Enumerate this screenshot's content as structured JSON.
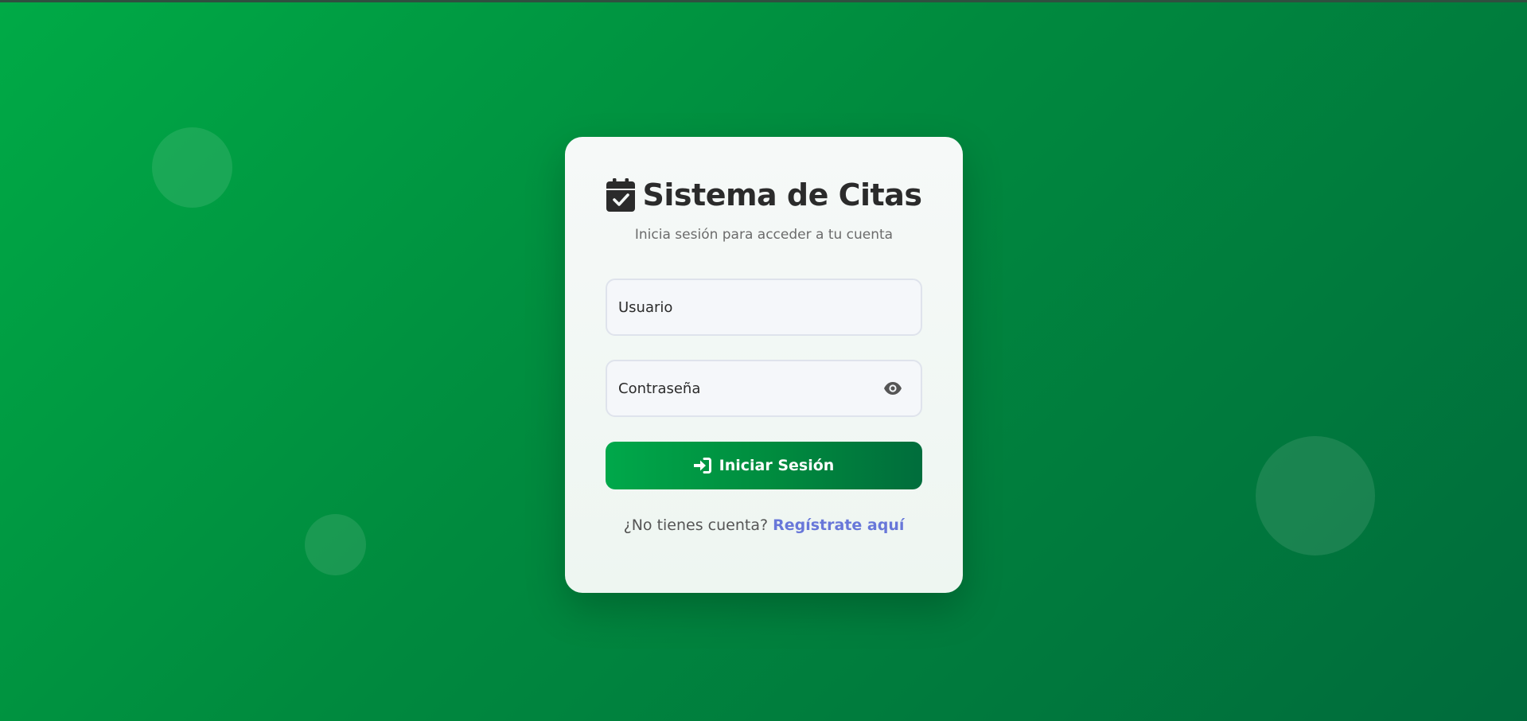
{
  "header": {
    "title": "Sistema de Citas",
    "subtitle": "Inicia sesión para acceder a tu cuenta",
    "icon": "calendar-check-icon"
  },
  "form": {
    "username": {
      "placeholder": "Usuario",
      "value": ""
    },
    "password": {
      "placeholder": "Contraseña",
      "value": "",
      "toggle_icon": "eye-icon"
    },
    "submit": {
      "label": "Iniciar Sesión",
      "icon": "sign-in-icon"
    }
  },
  "footer": {
    "prompt": "¿No tienes cuenta?",
    "link_label": "Regístrate aquí"
  },
  "colors": {
    "background_start": "#00aa46",
    "background_end": "#006b3c",
    "card": "#f4f8f6",
    "title_text": "#2b2b2b",
    "link": "#6877d9",
    "button_start": "#00a84a",
    "button_end": "#006d3c"
  }
}
